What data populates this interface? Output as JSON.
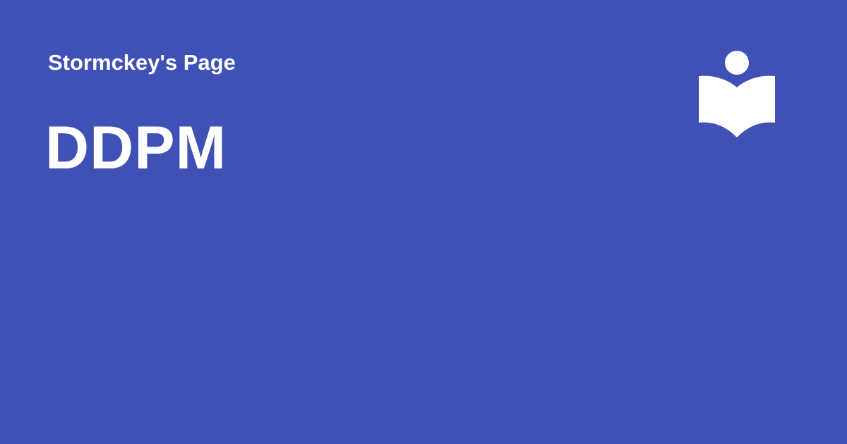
{
  "header": {
    "site_name": "Stormckey's Page"
  },
  "page": {
    "title": "DDPM"
  },
  "logo": {
    "icon": "reader-book-icon"
  },
  "colors": {
    "background": "#3f51b5",
    "foreground": "#ffffff"
  }
}
